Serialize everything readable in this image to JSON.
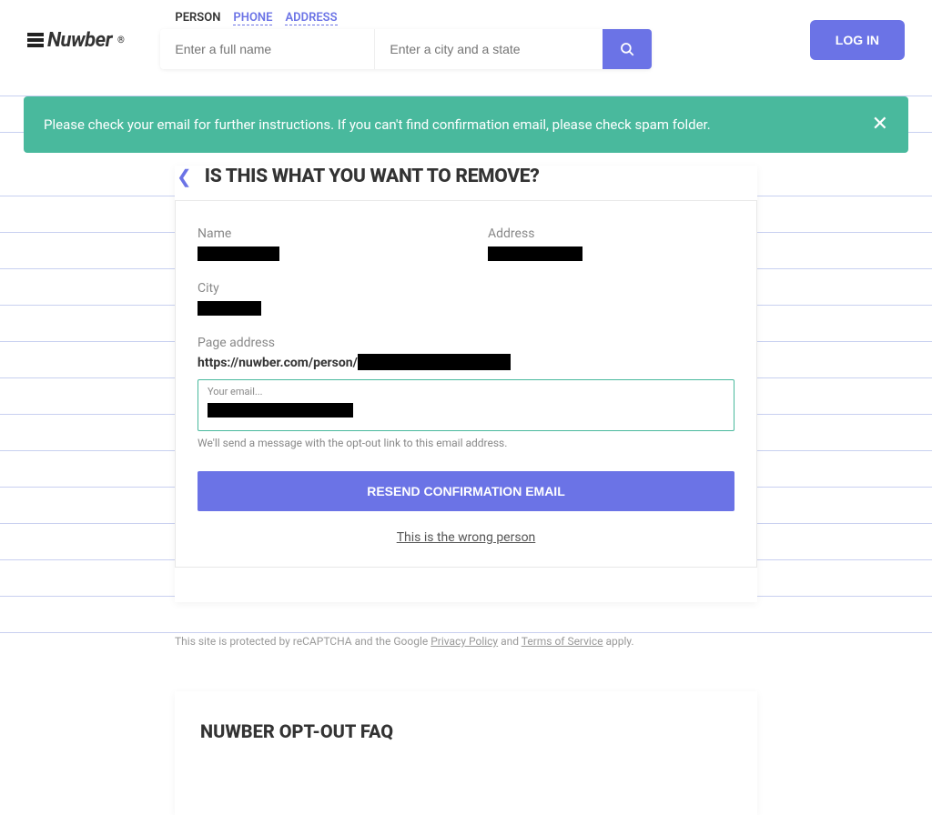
{
  "brand": {
    "name": "Nuwber",
    "reg": "®"
  },
  "tabs": {
    "person": "PERSON",
    "phone": "PHONE",
    "address": "ADDRESS"
  },
  "search": {
    "name_placeholder": "Enter a full name",
    "city_placeholder": "Enter a city and a state"
  },
  "login": "LOG IN",
  "toast": {
    "msg": "Please check your email for further instructions. If you can't find confirmation email, please check spam folder."
  },
  "remove": {
    "title": "IS THIS WHAT YOU WANT TO REMOVE?",
    "labels": {
      "name": "Name",
      "address": "Address",
      "city": "City",
      "page": "Page address"
    },
    "page_url_prefix": "https://nuwber.com/person/",
    "email_placeholder": "Your email...",
    "hint": "We'll send a message with the opt-out link to this email address.",
    "resend": "RESEND CONFIRMATION EMAIL",
    "wrong": "This is the wrong person"
  },
  "recaptcha": {
    "pre": "This site is protected by reCAPTCHA and the Google ",
    "pp": "Privacy Policy",
    "and": " and ",
    "tos": "Terms of Service",
    "post": " apply."
  },
  "faq": {
    "title": "NUWBER OPT-OUT FAQ"
  }
}
